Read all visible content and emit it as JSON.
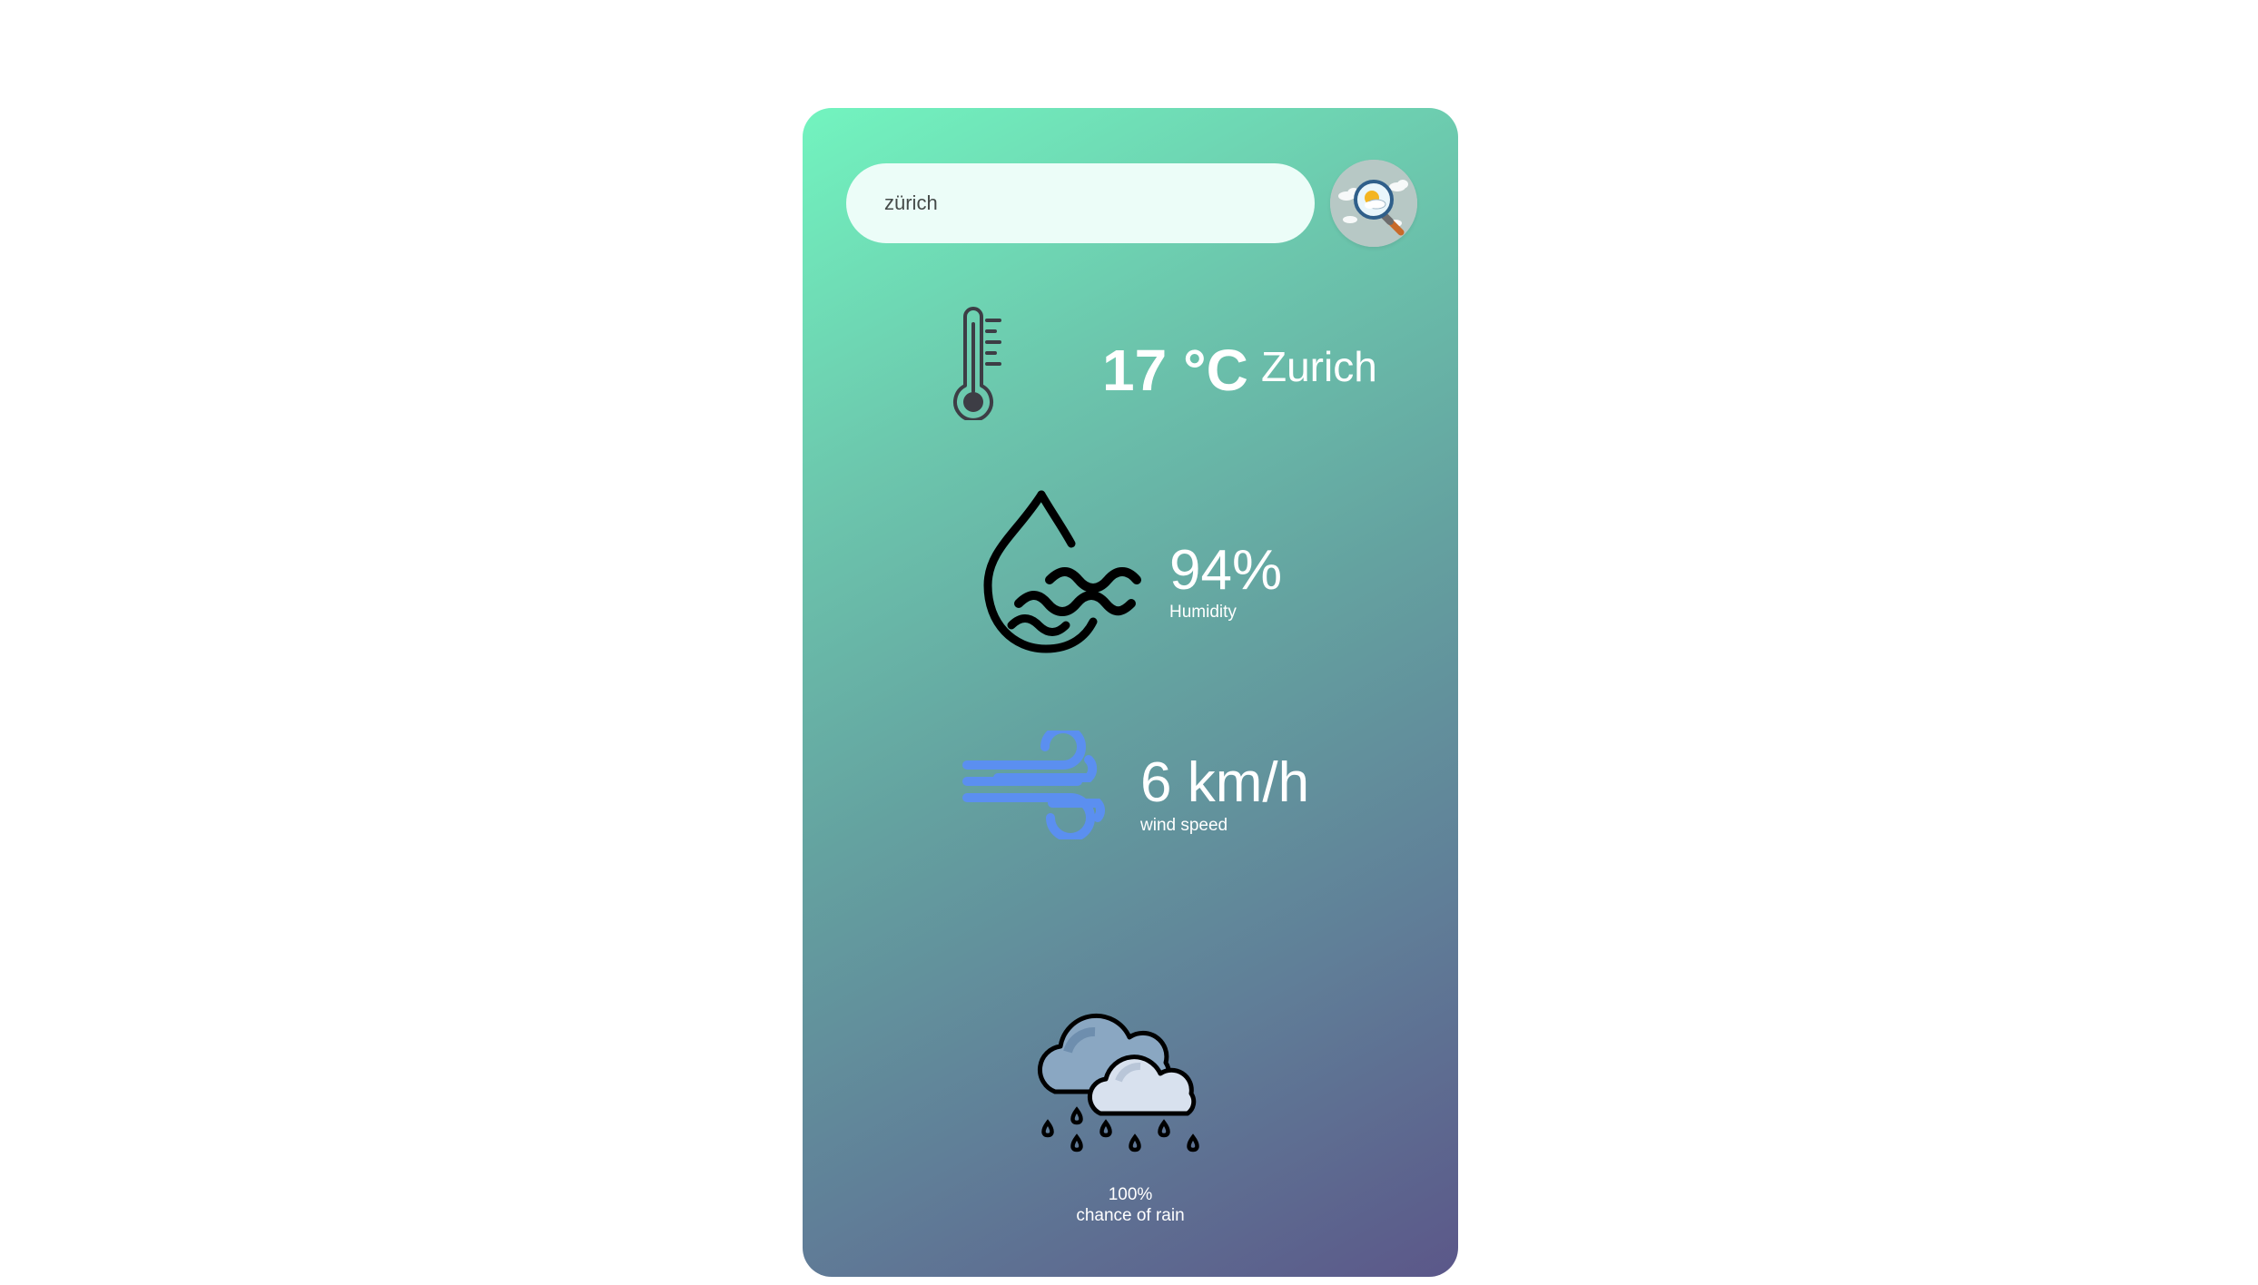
{
  "search": {
    "value": "zürich",
    "button_icon": "weather-search-icon"
  },
  "weather": {
    "temperature": "17 °C",
    "city": "Zurich",
    "humidity_value": "94%",
    "humidity_label": "Humidity",
    "wind_value": "6 km/h",
    "wind_label": "wind speed",
    "rain_value": "100%",
    "rain_label": "chance of rain"
  },
  "icons": {
    "temperature": "thermometer-icon",
    "humidity": "humidity-drop-icon",
    "wind": "wind-icon",
    "condition": "rain-clouds-icon"
  },
  "colors": {
    "gradient_start": "#72f4bf",
    "gradient_end": "#5b5789",
    "wind_icon": "#5b8ff0",
    "input_background": "#ecfdf8"
  }
}
